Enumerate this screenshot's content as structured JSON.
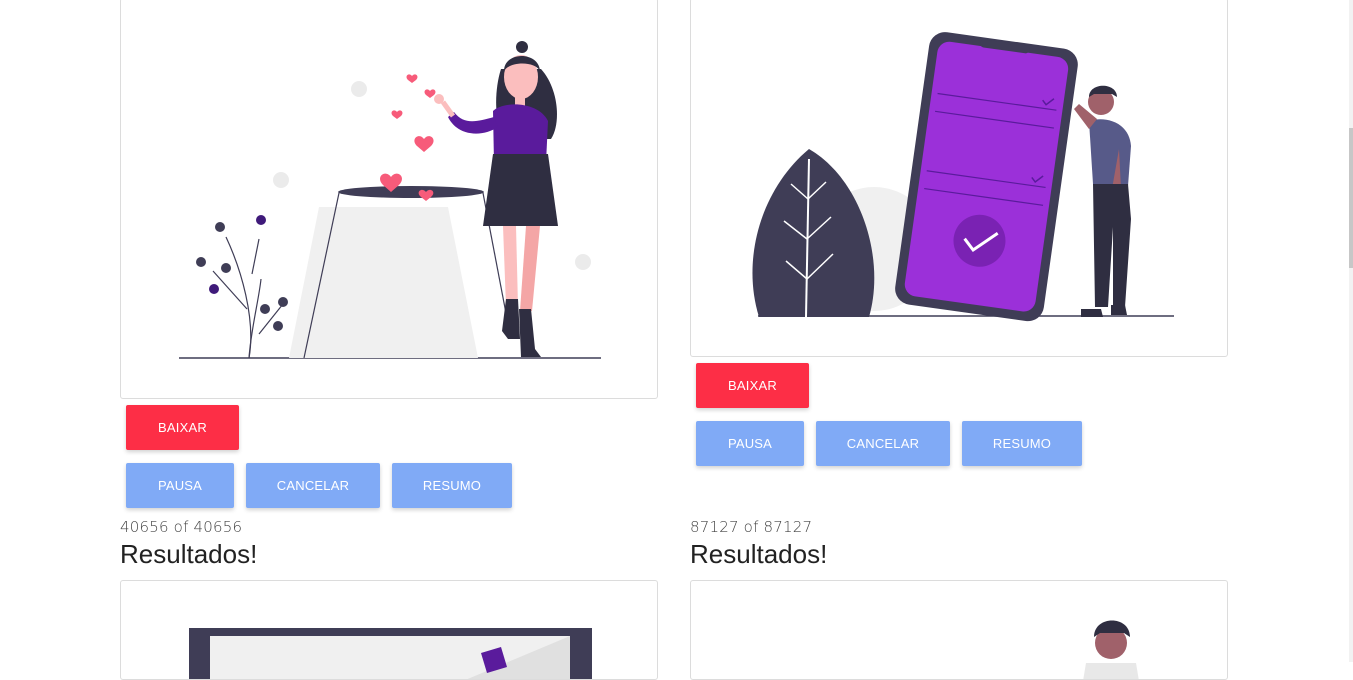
{
  "cards": [
    {
      "image_icon": "woman-with-hearts-illustration",
      "download_label": "BAIXAR",
      "pause_label": "PAUSA",
      "cancel_label": "CANCELAR",
      "resume_label": "RESUMO",
      "progress_text": "40656 of 40656",
      "results_title": "Resultados!"
    },
    {
      "image_icon": "man-with-phone-illustration",
      "download_label": "BAIXAR",
      "pause_label": "PAUSA",
      "cancel_label": "CANCELAR",
      "resume_label": "RESUMO",
      "progress_text": "87127 of 87127",
      "results_title": "Resultados!"
    }
  ],
  "colors": {
    "download_button": "#fd2e46",
    "control_button": "#80aaf6",
    "accent_purple": "#9b30d9",
    "dark": "#3f3d56"
  }
}
